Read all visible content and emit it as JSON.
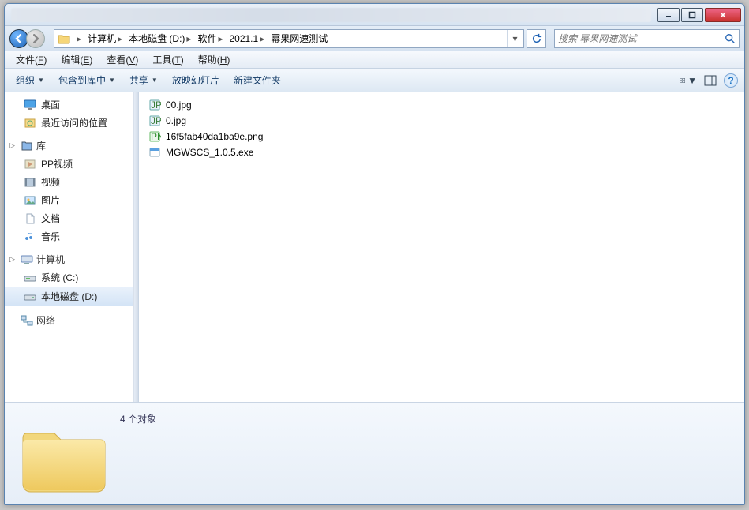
{
  "titlebar": {},
  "nav": {
    "crumbs": [
      "计算机",
      "本地磁盘 (D:)",
      "软件",
      "2021.1",
      "幂果网速测试"
    ]
  },
  "search": {
    "placeholder": "搜索 幂果网速测试"
  },
  "menubar": {
    "file": "文件(",
    "file_u": "F",
    "file_end": ")",
    "edit": "编辑(",
    "edit_u": "E",
    "edit_end": ")",
    "view": "查看(",
    "view_u": "V",
    "view_end": ")",
    "tools": "工具(",
    "tools_u": "T",
    "tools_end": ")",
    "help": "帮助(",
    "help_u": "H",
    "help_end": ")"
  },
  "toolbar": {
    "organize": "组织",
    "include": "包含到库中",
    "share": "共享",
    "slideshow": "放映幻灯片",
    "newfolder": "新建文件夹"
  },
  "sidebar": {
    "desktop": "桌面",
    "recent": "最近访问的位置",
    "lib": "库",
    "pp": "PP视频",
    "video": "视频",
    "pic": "图片",
    "doc": "文档",
    "music": "音乐",
    "computer": "计算机",
    "c": "系统 (C:)",
    "d": "本地磁盘 (D:)",
    "network": "网络"
  },
  "files": {
    "f1": "00.jpg",
    "f2": "0.jpg",
    "f3": "16f5fab40da1ba9e.png",
    "f4": "MGWSCS_1.0.5.exe"
  },
  "status": {
    "count": "4 个对象"
  }
}
